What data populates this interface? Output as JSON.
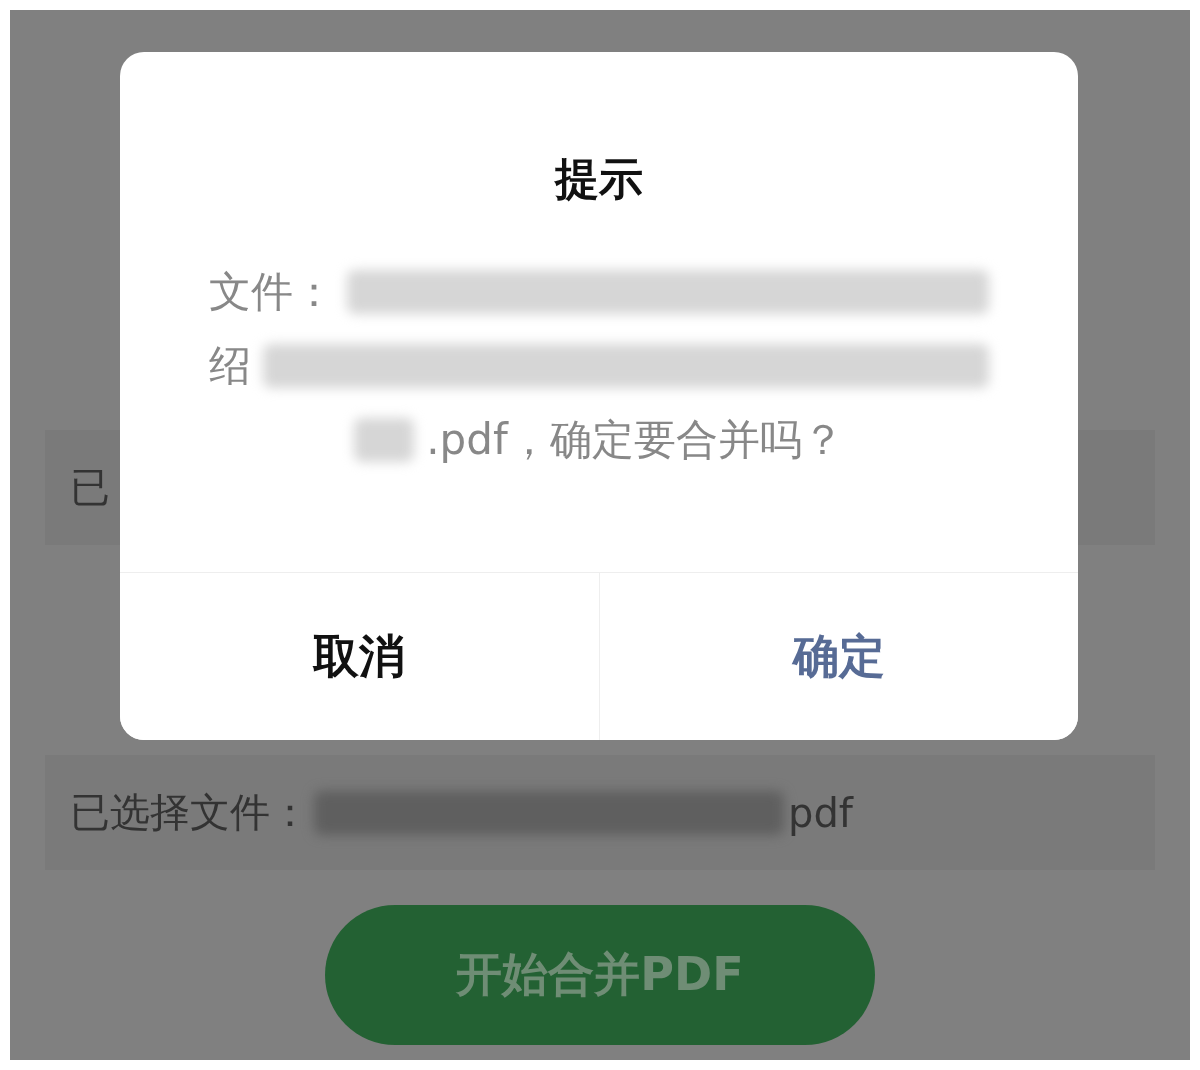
{
  "background": {
    "rows": [
      {
        "label": "已",
        "redacted": false,
        "suffix": ""
      },
      {
        "label": "已选择文件：",
        "redacted": true,
        "suffix": "pdf"
      }
    ],
    "merge_button": "开始合并PDF"
  },
  "dialog": {
    "title": "提示",
    "message_lines": [
      {
        "segments": [
          {
            "kind": "text",
            "text": "文件："
          },
          {
            "kind": "redacted"
          }
        ]
      },
      {
        "segments": [
          {
            "kind": "text",
            "text": "绍"
          },
          {
            "kind": "redacted"
          }
        ]
      },
      {
        "segments": [
          {
            "kind": "redacted"
          },
          {
            "kind": "text",
            "text": ".pdf，确定要合并吗？"
          }
        ]
      }
    ],
    "buttons": [
      {
        "label": "取消",
        "kind": "cancel"
      },
      {
        "label": "确定",
        "kind": "confirm"
      }
    ]
  }
}
